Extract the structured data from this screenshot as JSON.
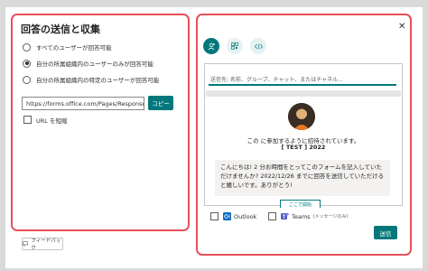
{
  "left_panel": {
    "title": "回答の送信と収集",
    "options": [
      {
        "label": "すべてのユーザーが回答可能",
        "selected": false
      },
      {
        "label": "自分の所属組織内のユーザーのみが回答可能",
        "selected": true
      },
      {
        "label": "自分の所属組織内の特定のユーザーが回答可能",
        "selected": false
      }
    ],
    "link_value": "https://forms.office.com/Pages/Response...",
    "copy_label": "コピー",
    "shorten_label": "URL を短縮"
  },
  "feedback_label": "フィードバック",
  "right_panel": {
    "to_placeholder": "送信先: 名前、グループ、チャット、またはチャネル...",
    "invite_line": "この に参加するように招待されています。",
    "form_name": "[ TEST ] 2022",
    "message": "こんにちは! 2 分お時間をとってこのフォームを記入していただけませんか? 2022/12/26 までに回答を送信していただけると嬉しいです。ありがとう!",
    "start_label": "ここで開始",
    "outlook_label": "Outlook",
    "teams_label": "Teams",
    "teams_sub": "(メッセージのみ)",
    "send_label": "送信"
  },
  "colors": {
    "accent": "#03787c",
    "highlight_border": "#e8505b",
    "backdrop": "#d9d9d9"
  }
}
